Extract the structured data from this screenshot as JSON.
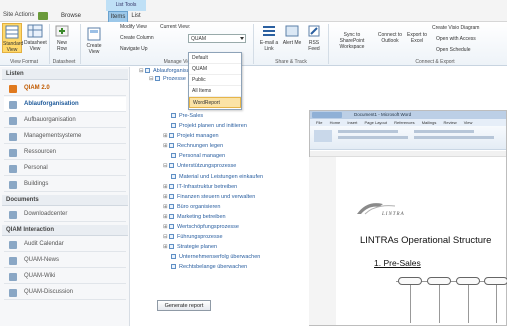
{
  "window": {
    "site_actions": "Site Actions",
    "tabs": [
      {
        "label": "Browse"
      },
      {
        "label": "Items"
      },
      {
        "label": "List"
      }
    ],
    "tools_tab": "List Tools"
  },
  "ribbon": {
    "buttons": [
      {
        "label": "Standard View"
      },
      {
        "label": "Datasheet View"
      },
      {
        "label": "New Row"
      },
      {
        "label": "Create View"
      },
      {
        "label": "E-mail a Link"
      },
      {
        "label": "Alert Me"
      },
      {
        "label": "RSS Feed"
      },
      {
        "label": "Sync to SharePoint Workspace"
      },
      {
        "label": "Connect to Outlook"
      },
      {
        "label": "Export to Excel"
      }
    ],
    "small_commands": {
      "modify_view": "Modify View",
      "current_view_label": "Current View:",
      "create_column": "Create Column",
      "navigate_up": "Navigate Up",
      "create_visio": "Create Visio Diagram",
      "open_access": "Open with Access",
      "open_schedule": "Open Schedule"
    },
    "current_view_value": "QUAM",
    "view_options": [
      "Default",
      "QUAM",
      "Public",
      "All Items",
      "WordReport"
    ],
    "selected_view": "WordReport",
    "group_labels": {
      "view_format": "View Format",
      "datasheet": "Datasheet",
      "manage_views": "Manage Views",
      "share_track": "Share & Track",
      "connect_export": "Connect & Export"
    }
  },
  "sidebar": {
    "sections": [
      {
        "title": "Listen"
      },
      {
        "title": "Documents"
      },
      {
        "title": "QIAM Interaction"
      }
    ],
    "items": [
      {
        "label": "QIAM 2.0"
      },
      {
        "label": "Ablauforganisation"
      },
      {
        "label": "Aufbauorganisation"
      },
      {
        "label": "Managementsysteme"
      },
      {
        "label": "Ressourcen"
      },
      {
        "label": "Personal"
      },
      {
        "label": "Buildings"
      },
      {
        "label": "Downloadcenter"
      },
      {
        "label": "Audit Calendar"
      },
      {
        "label": "QUAM-News"
      },
      {
        "label": "QUAM-Wiki"
      },
      {
        "label": "QUAM-Discussion"
      }
    ]
  },
  "tree": {
    "nodes": [
      "Ablauforganisation",
      "Prozesse",
      "Pre-Sales",
      "Projekt planen und initiieren",
      "Projekt managen",
      "Rechnungen legen",
      "Personal managen",
      "Unterstützungsprozesse",
      "Material und Leistungen einkaufen",
      "IT-Infrastruktur betreiben",
      "Finanzen steuern und verwalten",
      "Büro organisieren",
      "Marketing betreiben",
      "Wertschöpfungsprozesse",
      "Führungsprozesse",
      "Strategie planen",
      "Unternehmenserfolg überwachen",
      "Rechtsbelange überwachen"
    ],
    "generate_button": "Generate report"
  },
  "word": {
    "title": "Document1 - Microsoft Word",
    "tabs": [
      "File",
      "Home",
      "Insert",
      "Page Layout",
      "References",
      "Mailings",
      "Review",
      "View"
    ],
    "logo_text": "LINTRA",
    "doc_title": "LINTRAs Operational Structure",
    "heading": "1. Pre-Sales"
  }
}
